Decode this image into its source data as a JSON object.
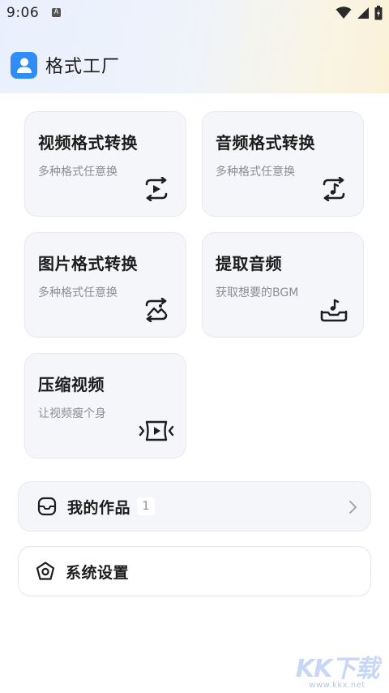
{
  "status_bar": {
    "time": "9:06",
    "notification_letter": "A"
  },
  "app": {
    "title": "格式工厂",
    "icon": "user-profile-icon"
  },
  "cards": [
    {
      "title": "视频格式转换",
      "subtitle": "多种格式任意换",
      "icon": "video-convert-icon"
    },
    {
      "title": "音频格式转换",
      "subtitle": "多种格式任意换",
      "icon": "audio-convert-icon"
    },
    {
      "title": "图片格式转换",
      "subtitle": "多种格式任意换",
      "icon": "image-convert-icon"
    },
    {
      "title": "提取音频",
      "subtitle": "获取想要的BGM",
      "icon": "extract-audio-icon"
    },
    {
      "title": "压缩视频",
      "subtitle": "让视频瘦个身",
      "icon": "compress-video-icon"
    }
  ],
  "my_works": {
    "label": "我的作品",
    "count": "1"
  },
  "settings": {
    "label": "系统设置"
  },
  "watermark": {
    "logo": "KK下载",
    "url": "www.kkx.net"
  },
  "colors": {
    "accent": "#2f8df5",
    "card_bg": "#f5f6f9",
    "text_primary": "#1c1c1c",
    "text_secondary": "#8a8d94"
  }
}
